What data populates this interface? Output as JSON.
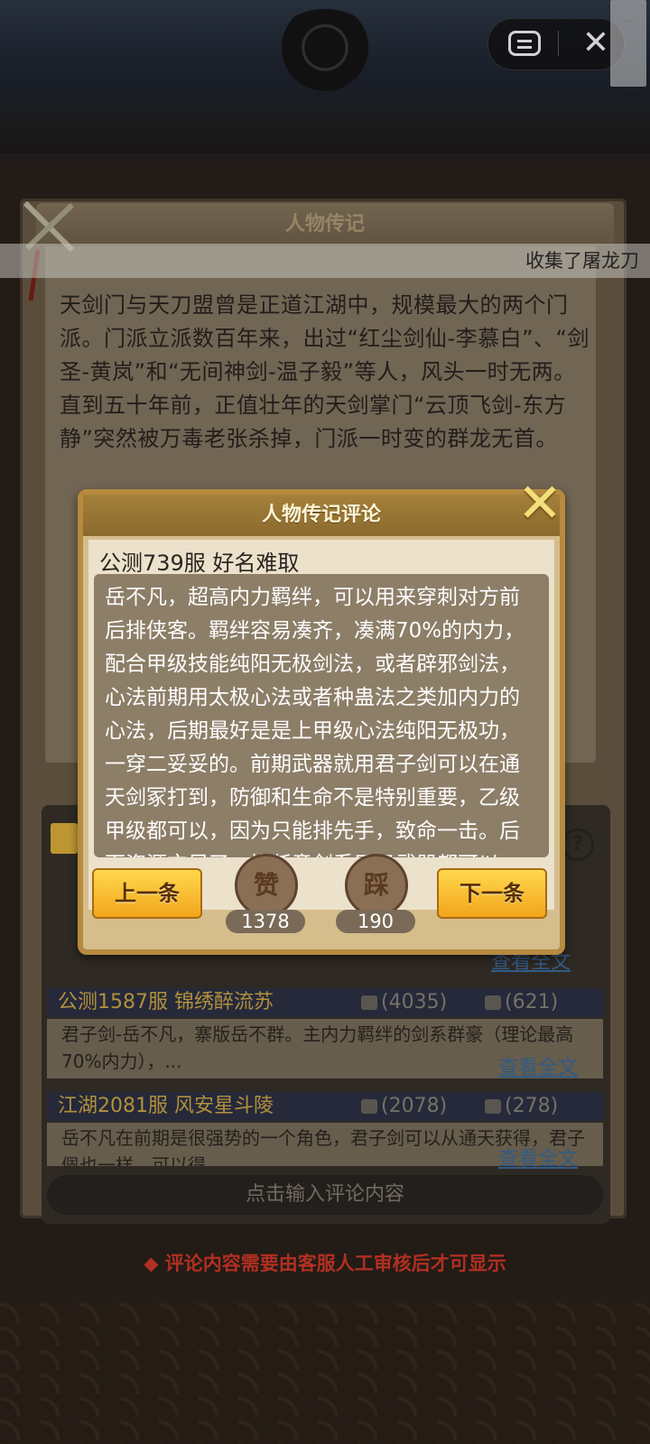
{
  "header": {
    "menu_icon": "menu-icon",
    "close_icon": "close-icon",
    "close_glyph": "✕"
  },
  "panel": {
    "title": "人物传记",
    "collect_banner": "收集了屠龙刀",
    "bio": "天剑门与天刀盟曾是正道江湖中，规模最大的两个门派。门派立派数百年来，出过“红尘剑仙-李慕白”、“剑圣-黄岚”和“无间神剑-温子毅”等人，风头一时无两。直到五十年前，正值壮年的天剑掌门“云顶飞剑-东方静”突然被万毒老张杀掉，门派一时变的群龙无首。"
  },
  "comments": [
    {
      "name": "公测1587服 锦绣醉流苏",
      "likes": "(4035)",
      "dislikes": "(621)",
      "text": "君子剑-岳不凡，寨版岳不群。主内力羁绊的剑系群豪（理论最高 70%内力），...",
      "view_all": "查看全文"
    },
    {
      "name": "江湖2081服 风安星斗陵",
      "likes": "(2078)",
      "dislikes": "(278)",
      "text": "岳不凡在前期是很强势的一个角色，君子剑可以从通天获得，君子佩也一样，可以得",
      "view_all": "查看全文"
    }
  ],
  "partial_view_all": "查看全文",
  "input_placeholder": "点击输入评论内容",
  "notice": "◆ 评论内容需要由客服人工审核后才可显示",
  "modal": {
    "title": "人物传记评论",
    "author": "公测739服 好名难取",
    "content": "岳不凡，超高内力羁绊，可以用来穿刺对方前后排侠客。羁绊容易凑齐，凑满70%的内力，配合甲级技能纯阳无极剑法，或者辟邪剑法，心法前期用太极心法或者种蛊法之类加内力的心法，后期最好是是上甲级心法纯阳无极功，一穿二妥妥的。前期武器就用君子剑可以在通天剑冢打到，防御和生命不是特别重要，乙级甲级都可以，因为只能排先手，致命一击。后面资源充足了，换任意剑系甲级武器都可以，前中期可以得留，后期",
    "prev_label": "上一条",
    "next_label": "下一条",
    "like_glyph": "赞",
    "dislike_glyph": "踩",
    "like_count": "1378",
    "dislike_count": "190"
  },
  "colors": {
    "accent_gold": "#d9b04a",
    "notice_red": "#d83a2a",
    "link_blue": "#3d6fa3"
  }
}
